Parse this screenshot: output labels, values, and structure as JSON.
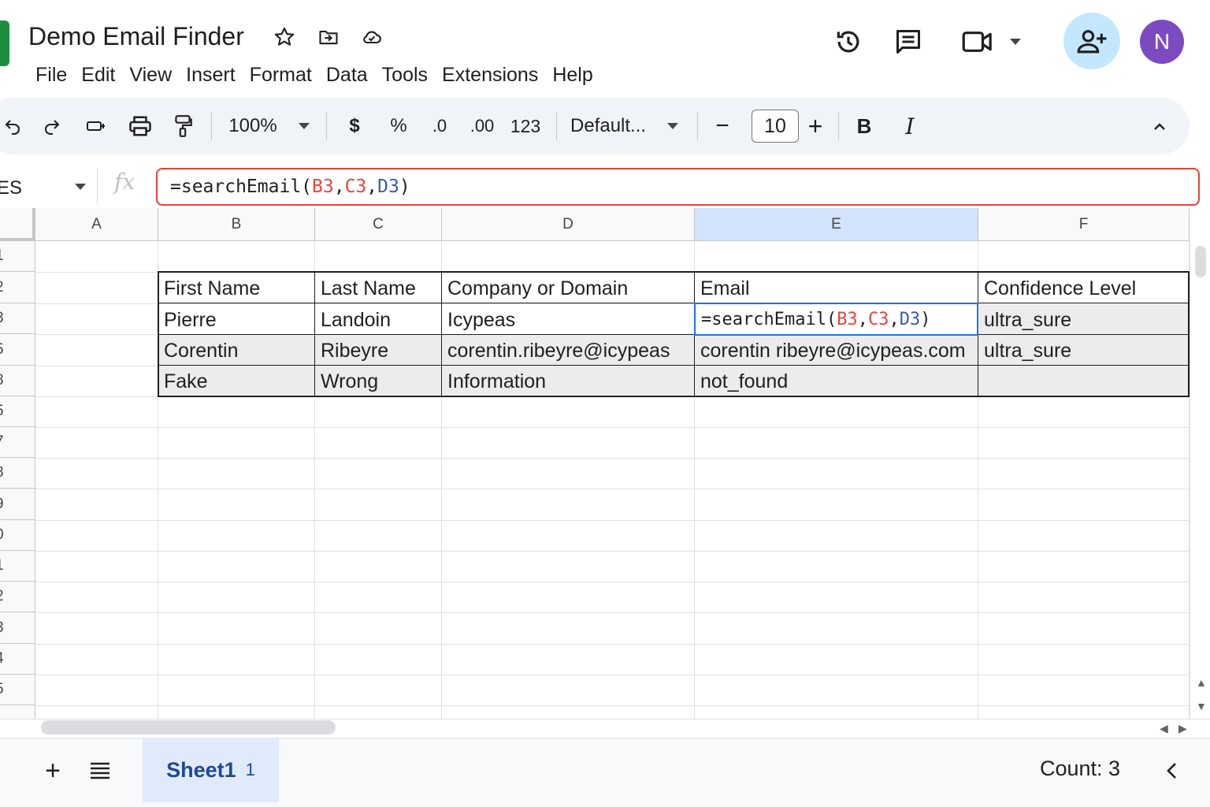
{
  "app": {
    "title": "Demo Email Finder",
    "menu": [
      "File",
      "Edit",
      "View",
      "Insert",
      "Format",
      "Data",
      "Tools",
      "Extensions",
      "Help"
    ],
    "avatar_initial": "N"
  },
  "toolbar": {
    "zoom": "100%",
    "currency": "$",
    "percent": "%",
    "decrease_decimal": ".0",
    "increase_decimal": ".00",
    "number_format": "123",
    "font": "Default...",
    "font_size": "10",
    "minus": "−",
    "plus": "+",
    "bold": "B",
    "italic": "I"
  },
  "formula_bar": {
    "name_box": "ES",
    "fx": "fx",
    "formula_prefix": "=searchEmail(",
    "ref1": "B3",
    "comma1": ",",
    "ref2": "C3",
    "comma2": ",",
    "ref3": "D3",
    "formula_suffix": ")"
  },
  "grid": {
    "columns": [
      "A",
      "B",
      "C",
      "D",
      "E",
      "F"
    ],
    "selected_column": "E",
    "row_numbers": [
      "1",
      "2",
      "3",
      "5",
      "8",
      "5",
      "7",
      "8",
      "9",
      "0",
      "1",
      "2",
      "3",
      "4",
      "5",
      "-"
    ],
    "headers": [
      "First Name",
      "Last Name",
      "Company or Domain",
      "Email",
      "Confidence Level"
    ],
    "rows": [
      [
        "Pierre",
        "Landoin",
        "Icypeas",
        "=searchEmail(B3,C3,D3)",
        "ultra_sure"
      ],
      [
        "Corentin",
        "Ribeyre",
        "corentin.ribeyre@icypeas",
        "corentin ribeyre@icypeas.com",
        "ultra_sure"
      ],
      [
        "Fake",
        "Wrong",
        "Information",
        "not_found",
        ""
      ]
    ]
  },
  "bottom": {
    "add": "+",
    "sheet_name": "Sheet1",
    "sheet_count": "1",
    "count": "Count: 3",
    "collapse": "‹"
  },
  "colors": {
    "accent": "#1a73e8",
    "formula_border": "#ea4335",
    "ref_red": "#e8453c",
    "ref_blue": "#3a5ca8",
    "avatar": "#7c4bbf",
    "share_bg": "#c2e7ff"
  }
}
